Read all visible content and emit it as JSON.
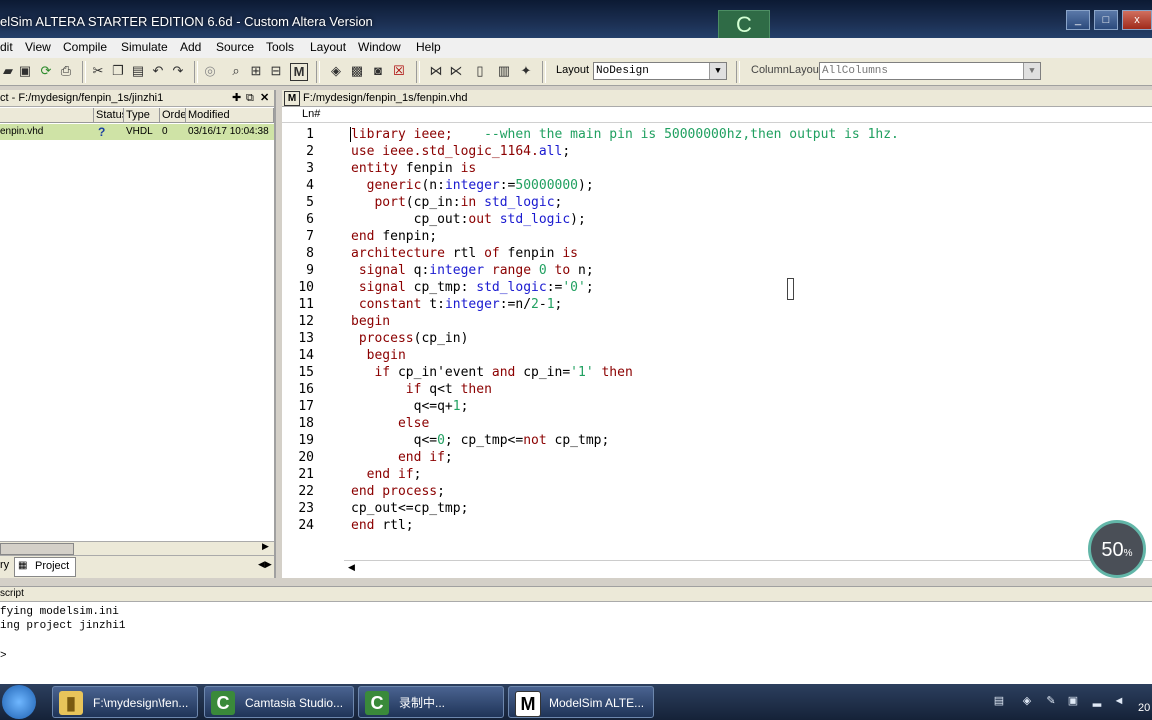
{
  "window": {
    "title": "elSim ALTERA STARTER EDITION 6.6d - Custom Altera Version"
  },
  "menu": [
    "dit",
    "View",
    "Compile",
    "Simulate",
    "Add",
    "Source",
    "Tools",
    "Layout",
    "Window",
    "Help"
  ],
  "toolbar": {
    "layout_label": "Layout",
    "layout_value": "NoDesign",
    "column_layout_label": "ColumnLayout",
    "column_layout_value": "AllColumns"
  },
  "project": {
    "header": "ct - F:/mydesign/fenpin_1s/jinzhi1",
    "columns": [
      "Status",
      "Type",
      "Order",
      "Modified"
    ],
    "row": {
      "name": "enpin.vhd",
      "status": "?",
      "type": "VHDL",
      "order": "0",
      "modified": "03/16/17 10:04:38"
    },
    "tab_left": "ry",
    "tab_project": "Project"
  },
  "editor": {
    "header": "F:/mydesign/fenpin_1s/fenpin.vhd",
    "ln_header": "Ln#",
    "lines": [
      [
        {
          "t": "library ieee;    ",
          "c": "kw"
        },
        {
          "t": "--when the main pin is 50000000hz,then output is 1hz.",
          "c": "cm"
        }
      ],
      [
        {
          "t": "use ieee.std_logic_1164.",
          "c": "kw"
        },
        {
          "t": "all",
          "c": "ty"
        },
        {
          "t": ";",
          "c": "pl"
        }
      ],
      [
        {
          "t": "entity ",
          "c": "kw"
        },
        {
          "t": "fenpin ",
          "c": "pl"
        },
        {
          "t": "is",
          "c": "kw"
        }
      ],
      [
        {
          "t": "  generic",
          "c": "kw"
        },
        {
          "t": "(n:",
          "c": "pl"
        },
        {
          "t": "integer",
          "c": "ty"
        },
        {
          "t": ":=",
          "c": "pl"
        },
        {
          "t": "50000000",
          "c": "nm"
        },
        {
          "t": ");",
          "c": "pl"
        }
      ],
      [
        {
          "t": "   port",
          "c": "kw"
        },
        {
          "t": "(cp_in:",
          "c": "pl"
        },
        {
          "t": "in ",
          "c": "kw"
        },
        {
          "t": "std_logic",
          "c": "ty"
        },
        {
          "t": ";",
          "c": "pl"
        }
      ],
      [
        {
          "t": "        cp_out:",
          "c": "pl"
        },
        {
          "t": "out ",
          "c": "kw"
        },
        {
          "t": "std_logic",
          "c": "ty"
        },
        {
          "t": ");",
          "c": "pl"
        }
      ],
      [
        {
          "t": "end ",
          "c": "kw"
        },
        {
          "t": "fenpin;",
          "c": "pl"
        }
      ],
      [
        {
          "t": "architecture ",
          "c": "kw"
        },
        {
          "t": "rtl ",
          "c": "pl"
        },
        {
          "t": "of ",
          "c": "kw"
        },
        {
          "t": "fenpin ",
          "c": "pl"
        },
        {
          "t": "is",
          "c": "kw"
        }
      ],
      [
        {
          "t": " signal ",
          "c": "kw"
        },
        {
          "t": "q:",
          "c": "pl"
        },
        {
          "t": "integer ",
          "c": "ty"
        },
        {
          "t": "range ",
          "c": "kw"
        },
        {
          "t": "0 ",
          "c": "nm"
        },
        {
          "t": "to ",
          "c": "kw"
        },
        {
          "t": "n;",
          "c": "pl"
        }
      ],
      [
        {
          "t": " signal ",
          "c": "kw"
        },
        {
          "t": "cp_tmp: ",
          "c": "pl"
        },
        {
          "t": "std_logic",
          "c": "ty"
        },
        {
          "t": ":=",
          "c": "pl"
        },
        {
          "t": "'0'",
          "c": "nm"
        },
        {
          "t": ";",
          "c": "pl"
        }
      ],
      [
        {
          "t": " constant ",
          "c": "kw"
        },
        {
          "t": "t:",
          "c": "pl"
        },
        {
          "t": "integer",
          "c": "ty"
        },
        {
          "t": ":=n/",
          "c": "pl"
        },
        {
          "t": "2",
          "c": "nm"
        },
        {
          "t": "-",
          "c": "pl"
        },
        {
          "t": "1",
          "c": "nm"
        },
        {
          "t": ";",
          "c": "pl"
        }
      ],
      [
        {
          "t": "begin",
          "c": "kw"
        }
      ],
      [
        {
          "t": " process",
          "c": "kw"
        },
        {
          "t": "(cp_in)",
          "c": "pl"
        }
      ],
      [
        {
          "t": "  begin",
          "c": "kw"
        }
      ],
      [
        {
          "t": "   if ",
          "c": "kw"
        },
        {
          "t": "cp_in'event ",
          "c": "pl"
        },
        {
          "t": "and ",
          "c": "kw"
        },
        {
          "t": "cp_in=",
          "c": "pl"
        },
        {
          "t": "'1' ",
          "c": "nm"
        },
        {
          "t": "then",
          "c": "kw"
        }
      ],
      [
        {
          "t": "       if ",
          "c": "kw"
        },
        {
          "t": "q<t ",
          "c": "pl"
        },
        {
          "t": "then",
          "c": "kw"
        }
      ],
      [
        {
          "t": "        q<=q+",
          "c": "pl"
        },
        {
          "t": "1",
          "c": "nm"
        },
        {
          "t": ";",
          "c": "pl"
        }
      ],
      [
        {
          "t": "      else",
          "c": "kw"
        }
      ],
      [
        {
          "t": "        q<=",
          "c": "pl"
        },
        {
          "t": "0",
          "c": "nm"
        },
        {
          "t": "; cp_tmp<=",
          "c": "pl"
        },
        {
          "t": "not ",
          "c": "kw"
        },
        {
          "t": "cp_tmp;",
          "c": "pl"
        }
      ],
      [
        {
          "t": "      end if",
          "c": "kw"
        },
        {
          "t": ";",
          "c": "pl"
        }
      ],
      [
        {
          "t": "  end if",
          "c": "kw"
        },
        {
          "t": ";",
          "c": "pl"
        }
      ],
      [
        {
          "t": "end process",
          "c": "kw"
        },
        {
          "t": ";",
          "c": "pl"
        }
      ],
      [
        {
          "t": "cp_out<=cp_tmp;",
          "c": "pl"
        }
      ],
      [
        {
          "t": "end ",
          "c": "kw"
        },
        {
          "t": "rtl;",
          "c": "pl"
        }
      ]
    ]
  },
  "transcript": {
    "header": "script",
    "lines": [
      "fying modelsim.ini",
      "ing project jinzhi1",
      "",
      ">"
    ]
  },
  "overlay": {
    "zoom": "50",
    "zoom_unit": "%"
  },
  "taskbar": {
    "items": [
      {
        "label": "F:\\mydesign\\fen...",
        "icon": "folder-icon"
      },
      {
        "label": "Camtasia Studio...",
        "icon": "camtasia-icon"
      },
      {
        "label": "录制中...",
        "icon": "camtasia-recorder-icon"
      },
      {
        "label": "ModelSim ALTE...",
        "icon": "modelsim-icon"
      }
    ],
    "clock": "20"
  },
  "colors": {
    "keyword": "#8b0000",
    "type": "#1a1ad0",
    "number": "#20a060",
    "selected_row": "#cfe3a6"
  }
}
